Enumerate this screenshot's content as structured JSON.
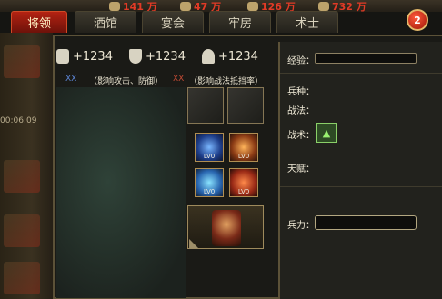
{
  "resources": [
    {
      "value": "141 万",
      "icon": "silver-coin-icon"
    },
    {
      "value": "47 万",
      "icon": "grain-icon"
    },
    {
      "value": "126 万",
      "icon": "wood-icon"
    },
    {
      "value": "732 万",
      "icon": "gold-icon"
    }
  ],
  "tabs": [
    {
      "label": "将领",
      "active": true
    },
    {
      "label": "酒馆",
      "active": false
    },
    {
      "label": "宴会",
      "active": false
    },
    {
      "label": "牢房",
      "active": false
    },
    {
      "label": "术士",
      "active": false
    }
  ],
  "close_badge": "2",
  "left_strip": {
    "timer": "00:06:09"
  },
  "stats": [
    {
      "icon": "sword-icon",
      "value": "+1234"
    },
    {
      "icon": "shield-icon",
      "value": "+1234"
    },
    {
      "icon": "person-icon",
      "value": "+1234"
    }
  ],
  "info_line": {
    "blue_xx": "XX",
    "left_text": "（影响攻击、防御）",
    "red_xx": "XX",
    "right_text": "（影响战法抵挡率）"
  },
  "skills": [
    {
      "level": "LV0",
      "icon": "lightning-skill-icon"
    },
    {
      "level": "LV0",
      "icon": "flame-skill-icon"
    },
    {
      "level": "LV0",
      "icon": "ice-skill-icon"
    },
    {
      "level": "LV0",
      "icon": "cavalry-skill-icon"
    }
  ],
  "detail": {
    "exp_label": "经验：",
    "troop_type_label": "兵种：",
    "battle_method_label": "战法：",
    "tactic_label": "战术：",
    "talent_label": "天赋：",
    "force_label": "兵力："
  }
}
